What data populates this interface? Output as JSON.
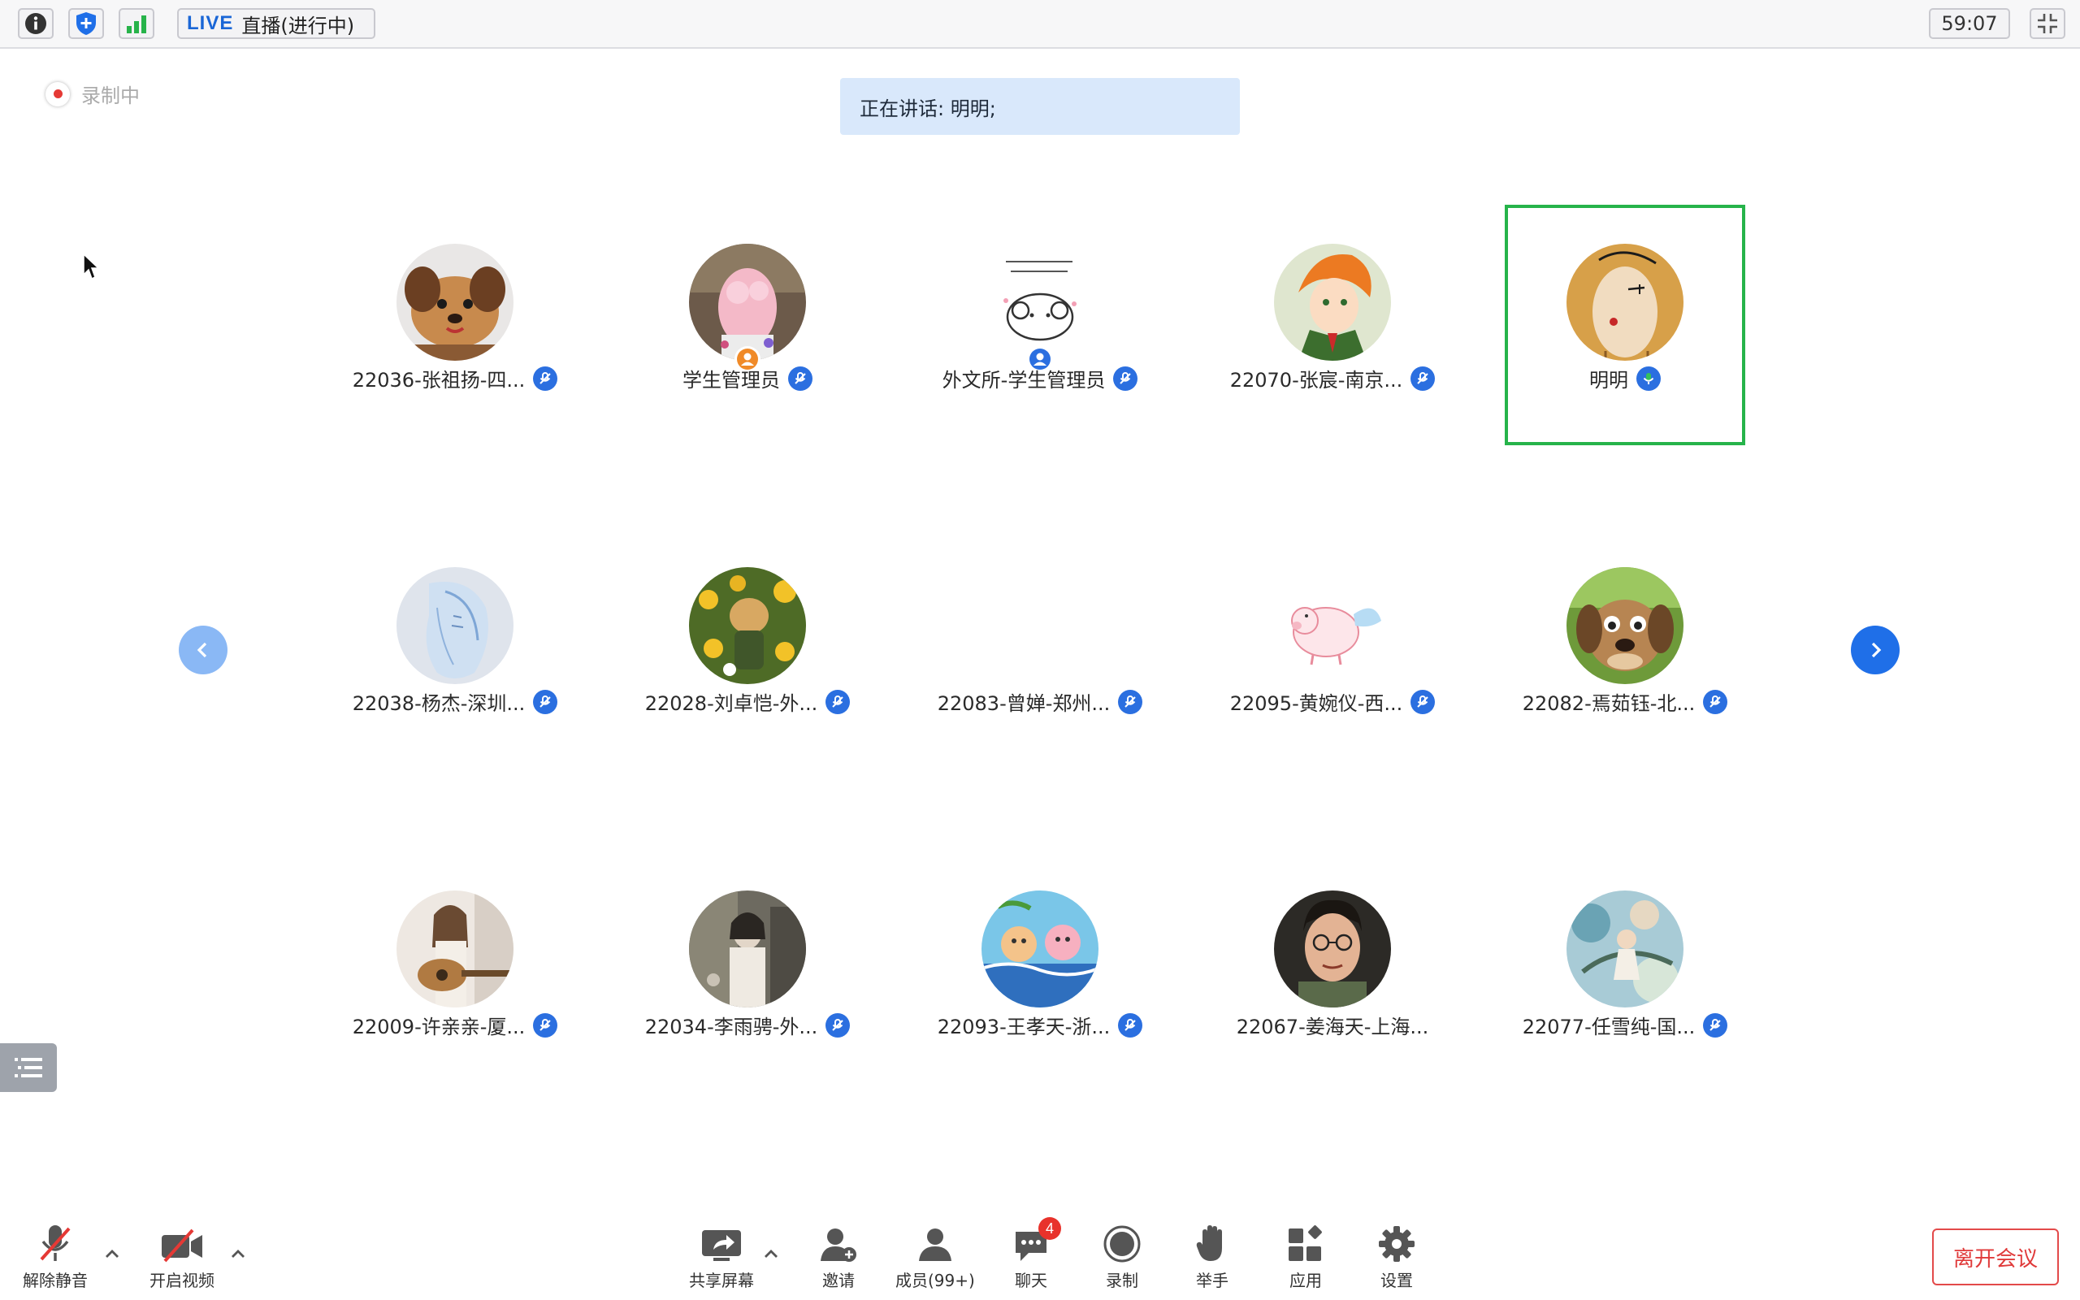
{
  "topbar": {
    "live_label": "LIVE",
    "live_status": "直播(进行中)",
    "timer": "59:07"
  },
  "recording": {
    "label": "录制中"
  },
  "speaking_banner": {
    "text": "正在讲话: 明明;"
  },
  "participants": [
    {
      "name": "22036-张祖扬-四...",
      "avatar": "toast-dog-photo",
      "mic": "muted"
    },
    {
      "name": "学生管理员",
      "avatar": "pink-plush-photo",
      "mic": "muted",
      "role_badge": "host"
    },
    {
      "name": "外文所-学生管理员",
      "avatar": "sheep-doodle",
      "mic": "muted",
      "role_badge": "co-host"
    },
    {
      "name": "22070-张宸-南京...",
      "avatar": "anime-boy",
      "mic": "muted"
    },
    {
      "name": "明明",
      "avatar": "wood-face",
      "mic": "speaking",
      "active": true
    },
    {
      "name": "22038-杨杰-深圳...",
      "avatar": "blue-sketch-girl",
      "mic": "muted"
    },
    {
      "name": "22028-刘卓恺-外...",
      "avatar": "cat-sunflowers",
      "mic": "muted"
    },
    {
      "name": "22083-曾婵-郑州...",
      "avatar": "blank",
      "mic": "muted"
    },
    {
      "name": "22095-黄婉仪-西...",
      "avatar": "winged-pig",
      "mic": "muted"
    },
    {
      "name": "22082-焉茹钰-北...",
      "avatar": "talking-dog",
      "mic": "muted"
    },
    {
      "name": "22009-许亲亲-厦...",
      "avatar": "guitar-girl",
      "mic": "muted"
    },
    {
      "name": "22034-李雨骋-外...",
      "avatar": "vintage-photo",
      "mic": "muted"
    },
    {
      "name": "22093-王孝天-浙...",
      "avatar": "cartoon-pigs",
      "mic": "muted"
    },
    {
      "name": "22067-姜海天-上海...",
      "avatar": "boy-glasses",
      "mic": "none"
    },
    {
      "name": "22077-任雪纯-国...",
      "avatar": "watercolor-girl",
      "mic": "muted"
    }
  ],
  "toolbar": {
    "unmute": "解除静音",
    "start_video": "开启视频",
    "share_screen": "共享屏幕",
    "invite": "邀请",
    "members": "成员(99+)",
    "chat": "聊天",
    "chat_badge": "4",
    "record": "录制",
    "raise_hand": "举手",
    "apps": "应用",
    "settings": "设置",
    "leave": "离开会议"
  },
  "colors": {
    "accent_blue": "#2b6fe0",
    "speaking_green": "#26b34a",
    "leave_red": "#e03a3a",
    "banner_bg": "#d9e8fb"
  }
}
